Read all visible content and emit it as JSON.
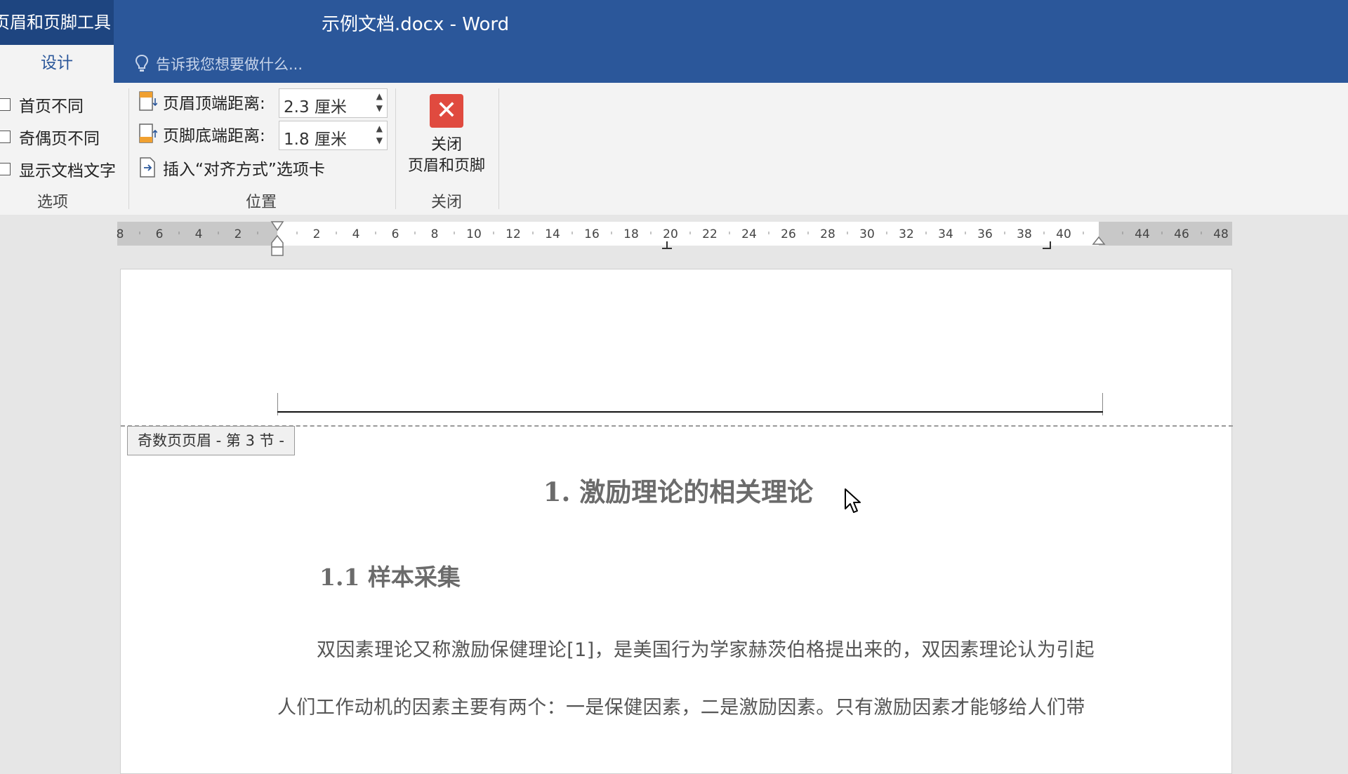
{
  "titlebar": {
    "context_tab": "页眉和页脚工具",
    "doc_title": "示例文档.docx - Word",
    "active_tab": "设计",
    "tellme_placeholder": "告诉我您想要做什么..."
  },
  "ribbon": {
    "options": {
      "items": [
        "首页不同",
        "奇偶页不同",
        "显示文档文字"
      ],
      "group_label": "选项"
    },
    "position": {
      "header_distance_label": "页眉顶端距离:",
      "header_distance_value": "2.3 厘米",
      "footer_distance_label": "页脚底端距离:",
      "footer_distance_value": "1.8 厘米",
      "insert_alignment_tab": "插入“对齐方式”选项卡",
      "group_label": "位置"
    },
    "close": {
      "button_line1": "关闭",
      "button_line2": "页眉和页脚",
      "group_label": "关闭"
    }
  },
  "ruler": {
    "labels": [
      "8",
      "6",
      "4",
      "2",
      "2",
      "4",
      "6",
      "8",
      "10",
      "12",
      "14",
      "16",
      "18",
      "20",
      "22",
      "24",
      "26",
      "28",
      "30",
      "32",
      "34",
      "36",
      "38",
      "40",
      "44",
      "46",
      "48"
    ]
  },
  "document": {
    "header_tag": "奇数页页眉 - 第 3 节 -",
    "heading1": "1. 激励理论的相关理论",
    "heading2": "1.1 样本采集",
    "paragraph_line1": "双因素理论又称激励保健理论[1]，是美国行为学家赫茨伯格提出来的，双因素理论认为引起",
    "paragraph_line2": "人们工作动机的因素主要有两个：一是保健因素，二是激励因素。只有激励因素才能够给人们带"
  },
  "colors": {
    "titlebar": "#2b579a",
    "close_icon": "#e04a3f"
  }
}
